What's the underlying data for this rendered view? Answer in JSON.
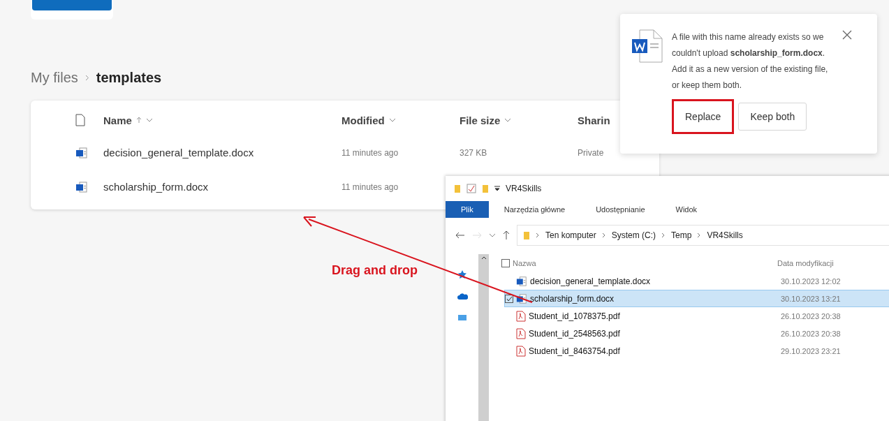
{
  "breadcrumb": [
    {
      "label": "My files",
      "current": false
    },
    {
      "label": "templates",
      "current": true
    }
  ],
  "file_list": {
    "columns": [
      {
        "label": "Name",
        "sorted": true,
        "dropdown": true
      },
      {
        "label": "Modified",
        "sorted": false,
        "dropdown": true
      },
      {
        "label": "File size",
        "sorted": false,
        "dropdown": true
      },
      {
        "label": "Sharin",
        "sorted": false,
        "dropdown": false
      }
    ],
    "rows": [
      {
        "name": "decision_general_template.docx",
        "modified": "11 minutes ago",
        "file_size": "327 KB",
        "sharing": "Private"
      },
      {
        "name": "scholarship_form.docx",
        "modified": "11 minutes ago"
      }
    ]
  },
  "dialog": {
    "message": "A file with this name already exists so we couldn't upload **scholarship_form.docx**. Add it as a new version of the existing file, or keep them both.",
    "buttons": [
      {
        "label": "Replace",
        "highlighted": true
      },
      {
        "label": "Keep both",
        "highlighted": false
      }
    ]
  },
  "explorer": {
    "title": "VR4Skills",
    "ribbon_tabs": [
      {
        "label": "Plik",
        "selected": true
      },
      {
        "label": "Narzędzia główne",
        "selected": false
      },
      {
        "label": "Udostępnianie",
        "selected": false
      },
      {
        "label": "Widok",
        "selected": false
      }
    ],
    "path": [
      "Ten komputer",
      "System (C:)",
      "Temp",
      "VR4Skills"
    ],
    "columns": [
      "Nazwa",
      "Data modyfikacji"
    ],
    "all_selected": false,
    "files": [
      {
        "name": "decision_general_template.docx",
        "date": "30.10.2023 12:02",
        "kind": "word",
        "selected": false
      },
      {
        "name": "scholarship_form.docx",
        "date": "30.10.2023 13:21",
        "kind": "word",
        "selected": true
      },
      {
        "name": "Student_id_1078375.pdf",
        "date": "26.10.2023 20:38",
        "kind": "pdf",
        "selected": false
      },
      {
        "name": "Student_id_2548563.pdf",
        "date": "26.10.2023 20:38",
        "kind": "pdf",
        "selected": false
      },
      {
        "name": "Student_id_8463754.pdf",
        "date": "29.10.2023 23:21",
        "kind": "pdf",
        "selected": false
      }
    ]
  },
  "annotation": {
    "label": "Drag and drop"
  }
}
